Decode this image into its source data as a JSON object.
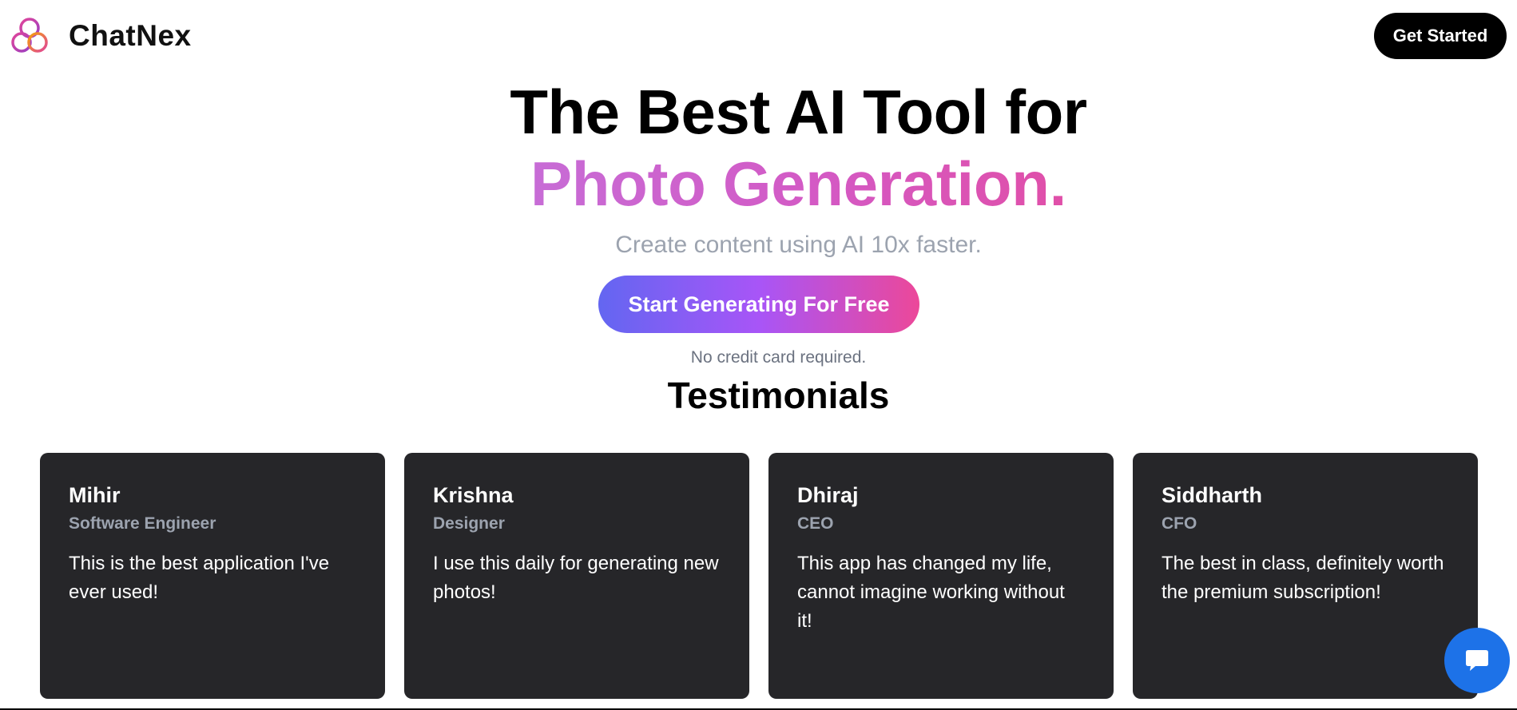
{
  "header": {
    "brand": "ChatNex",
    "cta_label": "Get Started"
  },
  "hero": {
    "title_line1": "The Best AI Tool for",
    "title_line2": "Photo Generation.",
    "subtitle": "Create content using AI 10x faster.",
    "cta_label": "Start Generating For Free",
    "note": "No credit card required."
  },
  "testimonials": {
    "heading": "Testimonials",
    "items": [
      {
        "name": "Mihir",
        "role": "Software Engineer",
        "quote": "This is the best application I've ever used!"
      },
      {
        "name": "Krishna",
        "role": "Designer",
        "quote": "I use this daily for generating new photos!"
      },
      {
        "name": "Dhiraj",
        "role": "CEO",
        "quote": "This app has changed my life, cannot imagine working without it!"
      },
      {
        "name": "Siddharth",
        "role": "CFO",
        "quote": "The best in class, definitely worth the premium subscription!"
      }
    ]
  },
  "icons": {
    "logo": "interlocking-rings-logo-icon",
    "chat": "chat-bubble-icon"
  },
  "colors": {
    "accent_gradient_start": "#6366f1",
    "accent_gradient_end": "#ec4899",
    "highlight_text": "#d459c4",
    "card_background": "#262629",
    "chat_button": "#1d72e8"
  }
}
